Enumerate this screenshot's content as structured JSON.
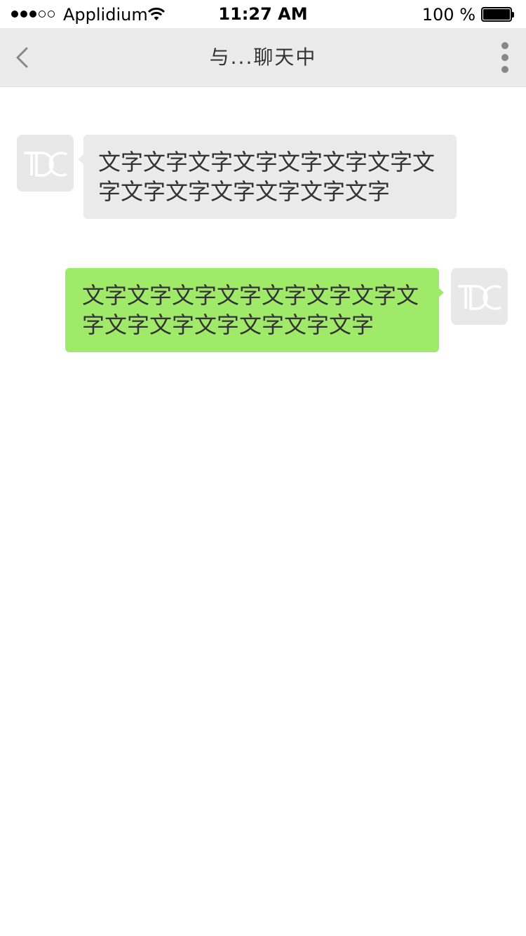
{
  "status_bar": {
    "carrier": "Applidium",
    "time": "11:27 AM",
    "battery_percent": "100 %",
    "signal_bars_filled": 3,
    "signal_bars_total": 5,
    "battery_level": 1.0
  },
  "nav_bar": {
    "title": "与...聊天中",
    "back_icon": "chevron-left-icon",
    "more_icon": "more-vertical-icon"
  },
  "messages": [
    {
      "direction": "received",
      "avatar_text": "TDC",
      "text": "文字文字文字文字文字文字文字文字文字文字文字文字文字文字"
    },
    {
      "direction": "sent",
      "avatar_text": "TDC",
      "text": "文字文字文字文字文字文字文字文字文字文字文字文字文字文字"
    }
  ],
  "colors": {
    "nav_background": "#ebebeb",
    "received_bubble": "#ebebeb",
    "sent_bubble": "#a0ea6a",
    "text": "#333333",
    "icon_gray": "#888888"
  }
}
